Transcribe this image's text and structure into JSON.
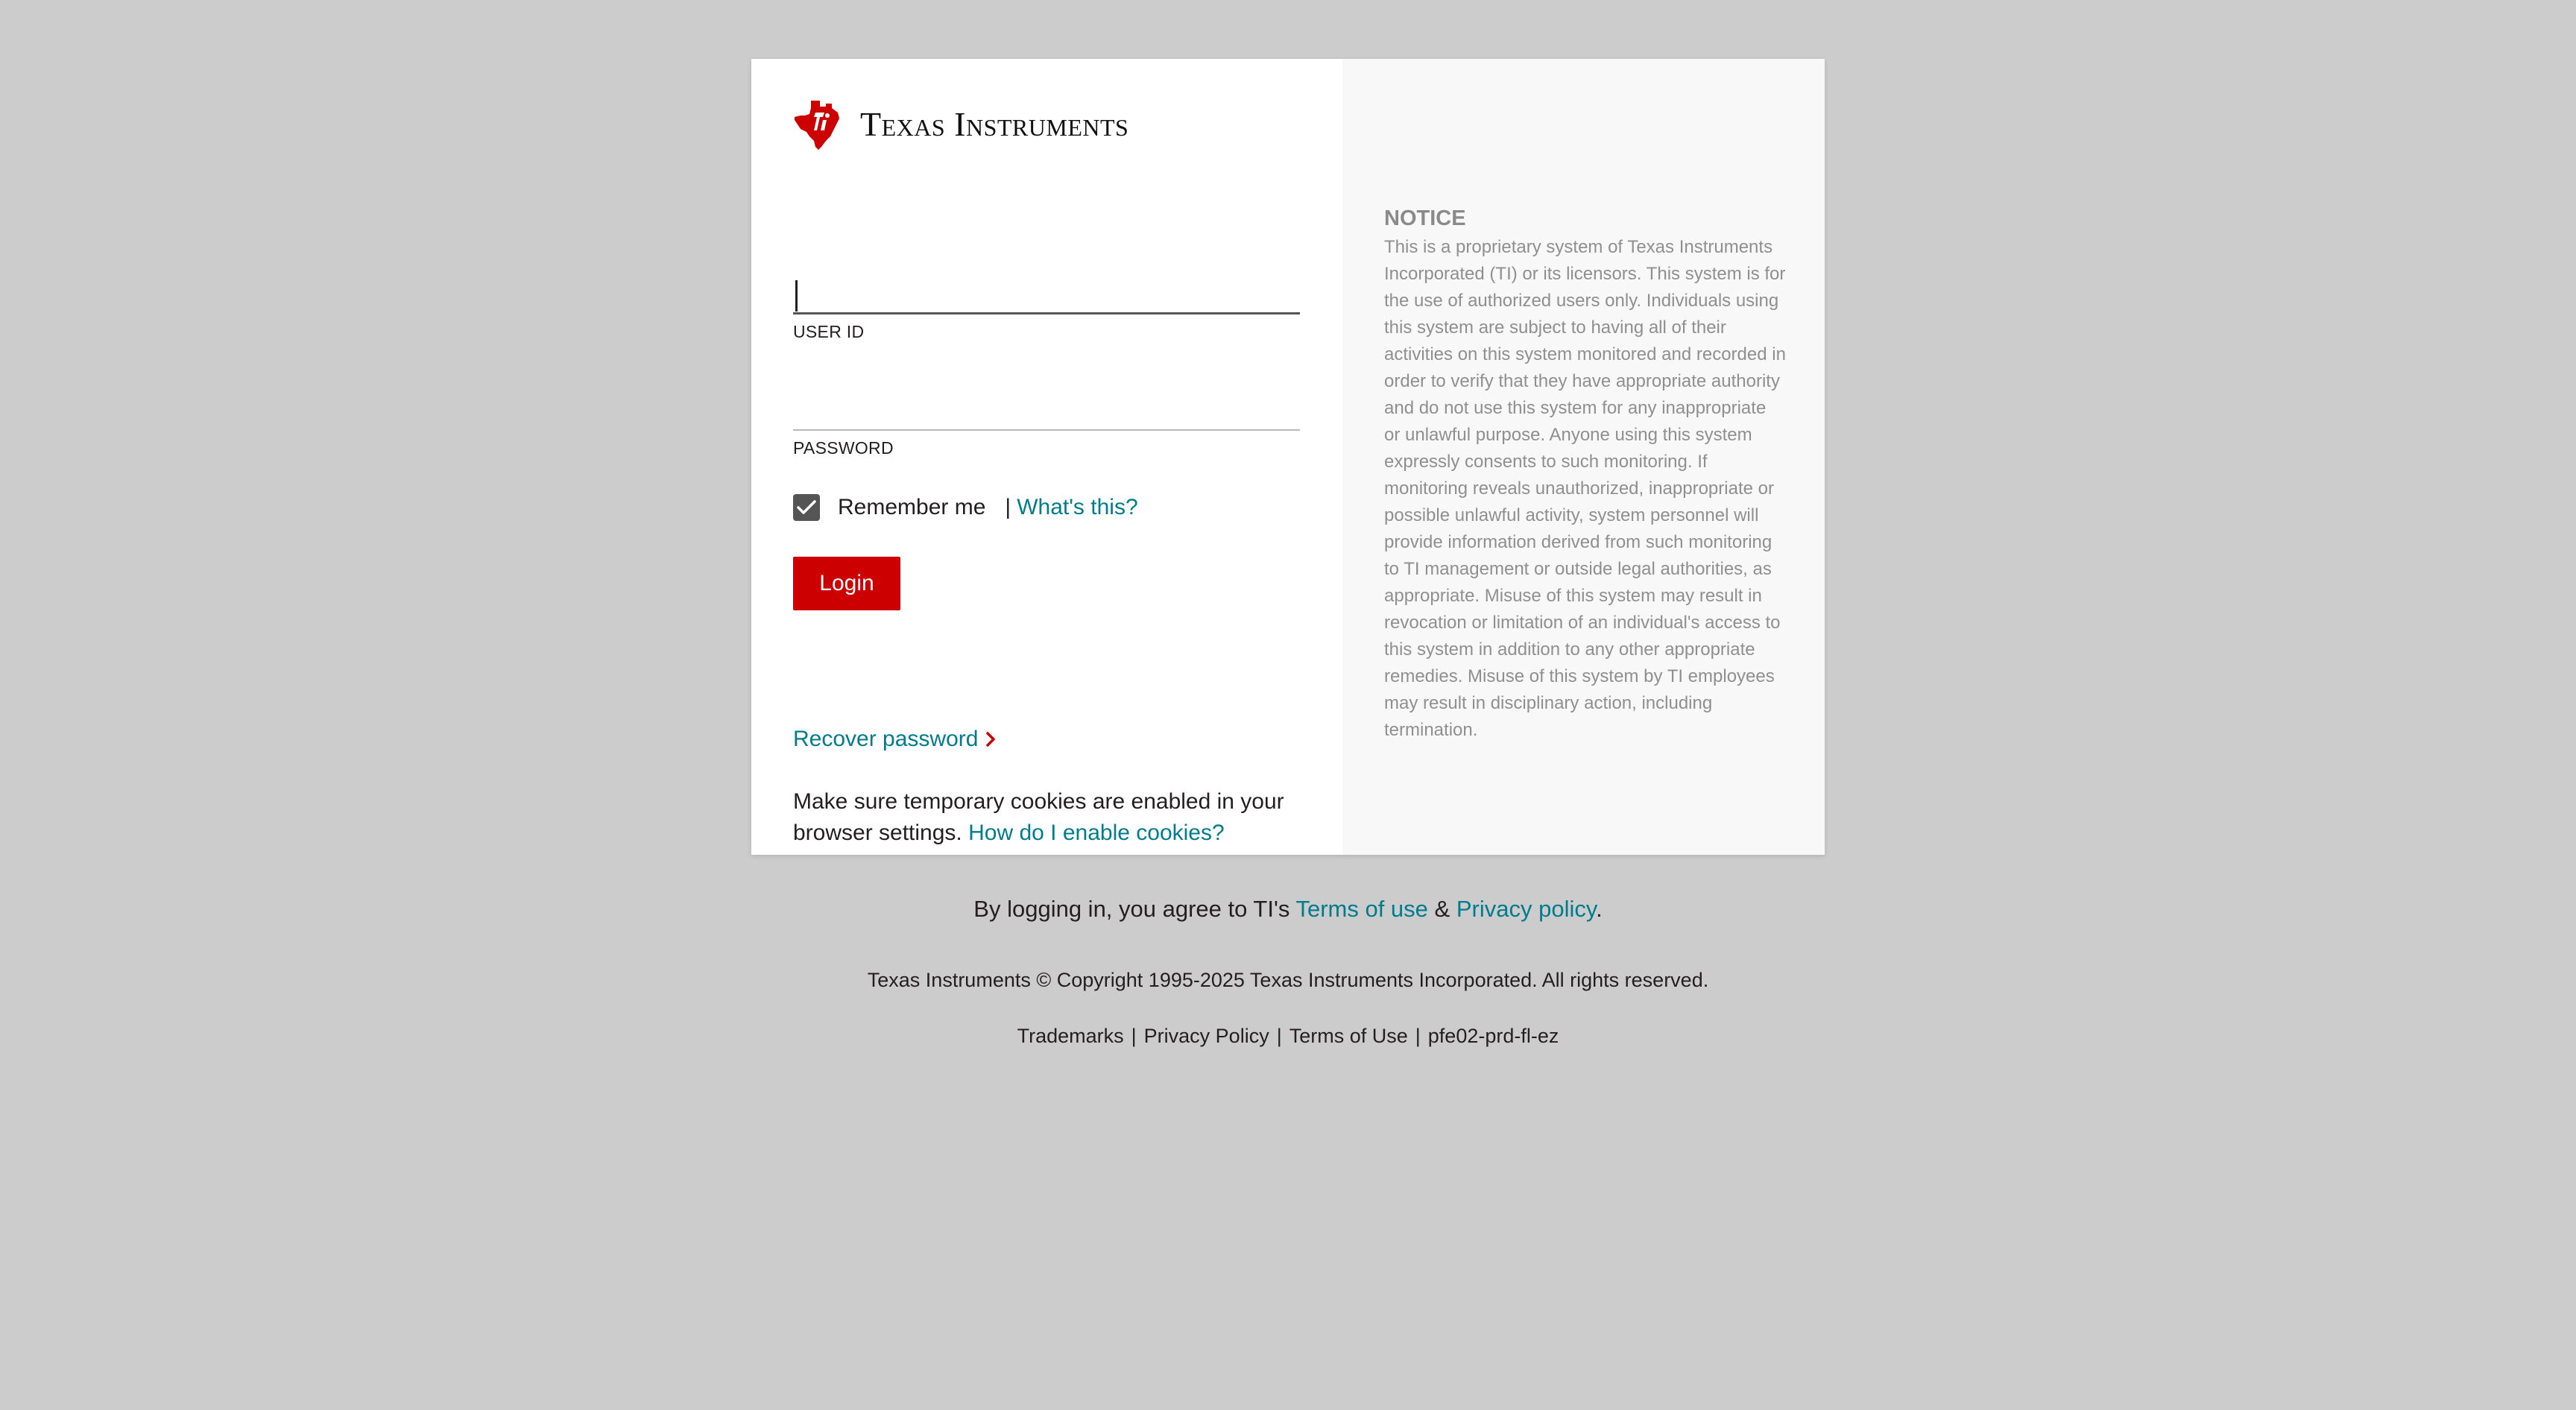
{
  "brand": {
    "name": "Texas Instruments",
    "accent_color": "#cc0000",
    "link_color": "#007c8c",
    "logo_icon": "ti-logo-icon"
  },
  "form": {
    "userid_label": "USER ID",
    "userid_value": "",
    "password_label": "PASSWORD",
    "password_value": "",
    "remember_checked": true,
    "remember_label": "Remember me",
    "separator": "|",
    "whats_this_link": "What's this?",
    "login_button": "Login"
  },
  "recover": {
    "label": "Recover password",
    "icon": "chevron-right-icon"
  },
  "cookies": {
    "text": "Make sure temporary cookies are enabled in your browser settings.",
    "link": "How do I enable cookies?"
  },
  "notice": {
    "title": "NOTICE",
    "body": "This is a proprietary system of Texas Instruments Incorporated (TI) or its licensors. This system is for the use of authorized users only. Individuals using this system are subject to having all of their activities on this system monitored and recorded in order to verify that they have appropriate authority and do not use this system for any inappropriate or unlawful purpose. Anyone using this system expressly consents to such monitoring. If monitoring reveals unauthorized, inappropriate or possible unlawful activity, system personnel will provide information derived from such monitoring to TI management or outside legal authorities, as appropriate. Misuse of this system may result in revocation or limitation of an individual's access to this system in addition to any other appropriate remedies. Misuse of this system by TI employees may result in disciplinary action, including termination."
  },
  "agreement": {
    "prefix": "By logging in, you agree to TI's",
    "terms_link": "Terms of use",
    "amp": "&",
    "privacy_link": "Privacy policy",
    "suffix": "."
  },
  "footer": {
    "copyright": "Texas Instruments © Copyright 1995-2025 Texas Instruments Incorporated. All rights reserved.",
    "links": [
      "Trademarks",
      "Privacy Policy",
      "Terms of Use"
    ],
    "server_id": "pfe02-prd-fl-ez"
  }
}
